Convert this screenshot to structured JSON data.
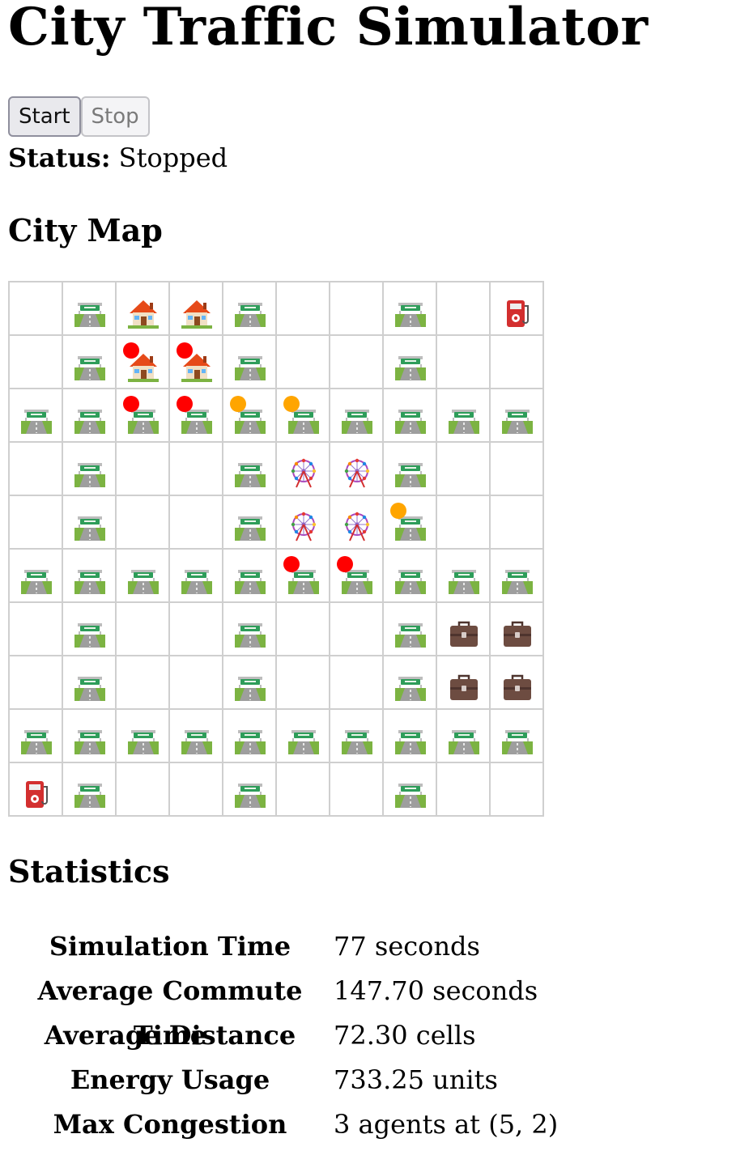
{
  "app": {
    "title": "City Traffic Simulator",
    "start_label": "Start",
    "stop_label": "Stop",
    "status_label": "Status:",
    "status_value": "Stopped"
  },
  "map": {
    "title": "City Map",
    "legend_colors": {
      "red": "#ff0000",
      "orange": "#ffa500"
    },
    "rows": [
      [
        {
          "t": "empty"
        },
        {
          "t": "road"
        },
        {
          "t": "house"
        },
        {
          "t": "house"
        },
        {
          "t": "road"
        },
        {
          "t": "empty"
        },
        {
          "t": "empty"
        },
        {
          "t": "road"
        },
        {
          "t": "empty"
        },
        {
          "t": "fuel"
        }
      ],
      [
        {
          "t": "empty"
        },
        {
          "t": "road"
        },
        {
          "t": "house",
          "agent": "red"
        },
        {
          "t": "house",
          "agent": "red"
        },
        {
          "t": "road"
        },
        {
          "t": "empty"
        },
        {
          "t": "empty"
        },
        {
          "t": "road"
        },
        {
          "t": "empty"
        },
        {
          "t": "empty"
        }
      ],
      [
        {
          "t": "road"
        },
        {
          "t": "road"
        },
        {
          "t": "road",
          "agent": "red"
        },
        {
          "t": "road",
          "agent": "red"
        },
        {
          "t": "road",
          "agent": "orange"
        },
        {
          "t": "road",
          "agent": "orange"
        },
        {
          "t": "road"
        },
        {
          "t": "road"
        },
        {
          "t": "road"
        },
        {
          "t": "road"
        }
      ],
      [
        {
          "t": "empty"
        },
        {
          "t": "road"
        },
        {
          "t": "empty"
        },
        {
          "t": "empty"
        },
        {
          "t": "road"
        },
        {
          "t": "ferris"
        },
        {
          "t": "ferris"
        },
        {
          "t": "road"
        },
        {
          "t": "empty"
        },
        {
          "t": "empty"
        }
      ],
      [
        {
          "t": "empty"
        },
        {
          "t": "road"
        },
        {
          "t": "empty"
        },
        {
          "t": "empty"
        },
        {
          "t": "road"
        },
        {
          "t": "ferris"
        },
        {
          "t": "ferris"
        },
        {
          "t": "road",
          "agent": "orange"
        },
        {
          "t": "empty"
        },
        {
          "t": "empty"
        }
      ],
      [
        {
          "t": "road"
        },
        {
          "t": "road"
        },
        {
          "t": "road"
        },
        {
          "t": "road"
        },
        {
          "t": "road"
        },
        {
          "t": "road",
          "agent": "red"
        },
        {
          "t": "road",
          "agent": "red"
        },
        {
          "t": "road"
        },
        {
          "t": "road"
        },
        {
          "t": "road"
        }
      ],
      [
        {
          "t": "empty"
        },
        {
          "t": "road"
        },
        {
          "t": "empty"
        },
        {
          "t": "empty"
        },
        {
          "t": "road"
        },
        {
          "t": "empty"
        },
        {
          "t": "empty"
        },
        {
          "t": "road"
        },
        {
          "t": "work"
        },
        {
          "t": "work"
        }
      ],
      [
        {
          "t": "empty"
        },
        {
          "t": "road"
        },
        {
          "t": "empty"
        },
        {
          "t": "empty"
        },
        {
          "t": "road"
        },
        {
          "t": "empty"
        },
        {
          "t": "empty"
        },
        {
          "t": "road"
        },
        {
          "t": "work"
        },
        {
          "t": "work"
        }
      ],
      [
        {
          "t": "road"
        },
        {
          "t": "road"
        },
        {
          "t": "road"
        },
        {
          "t": "road"
        },
        {
          "t": "road"
        },
        {
          "t": "road"
        },
        {
          "t": "road"
        },
        {
          "t": "road"
        },
        {
          "t": "road"
        },
        {
          "t": "road"
        }
      ],
      [
        {
          "t": "fuel"
        },
        {
          "t": "road"
        },
        {
          "t": "empty"
        },
        {
          "t": "empty"
        },
        {
          "t": "road"
        },
        {
          "t": "empty"
        },
        {
          "t": "empty"
        },
        {
          "t": "road"
        },
        {
          "t": "empty"
        },
        {
          "t": "empty"
        }
      ]
    ]
  },
  "stats": {
    "title": "Statistics",
    "rows": [
      {
        "label": "Simulation Time",
        "value": "77 seconds"
      },
      {
        "label": "Average Commute Time",
        "value": "147.70 seconds"
      },
      {
        "label": "Average Distance",
        "value": "72.30 cells"
      },
      {
        "label": "Energy Usage",
        "value": "733.25 units"
      },
      {
        "label": "Max Congestion",
        "value": "3 agents at (5, 2)"
      }
    ]
  }
}
